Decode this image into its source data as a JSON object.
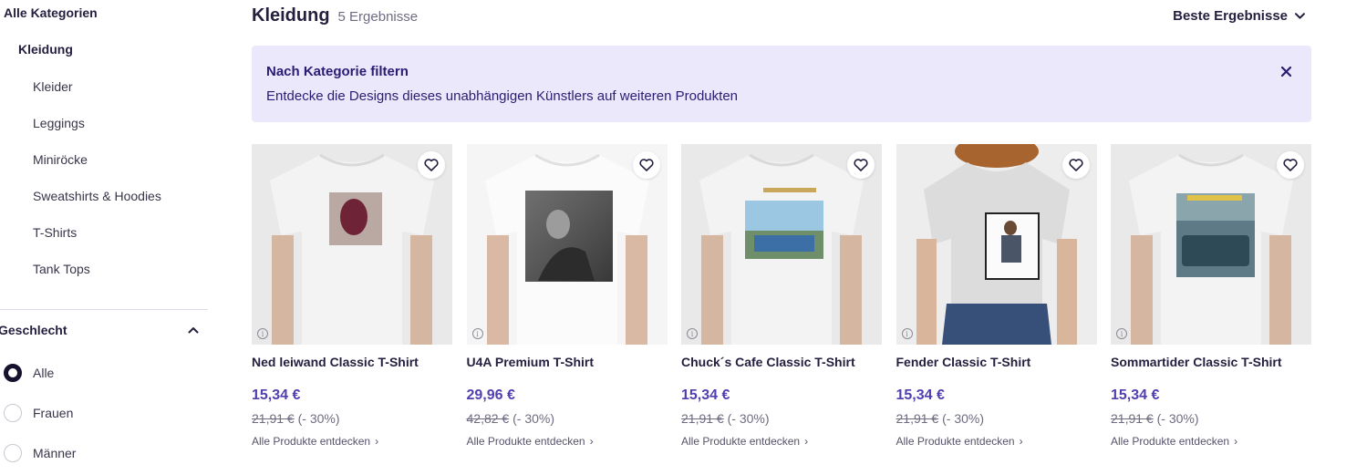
{
  "sidebar": {
    "all_categories": "Alle Kategorien",
    "category": "Kleidung",
    "subcategories": [
      {
        "label": "Kleider"
      },
      {
        "label": "Leggings"
      },
      {
        "label": "Miniröcke"
      },
      {
        "label": "Sweatshirts & Hoodies"
      },
      {
        "label": "T-Shirts"
      },
      {
        "label": "Tank Tops"
      }
    ],
    "gender_title": "Geschlecht",
    "gender_options": [
      {
        "label": "Alle",
        "selected": true
      },
      {
        "label": "Frauen",
        "selected": false
      },
      {
        "label": "Männer",
        "selected": false
      }
    ]
  },
  "header": {
    "title": "Kleidung",
    "count": "5 Ergebnisse",
    "sort_label": "Beste Ergebnisse"
  },
  "banner": {
    "title": "Nach Kategorie filtern",
    "text": "Entdecke die Designs dieses unabhängigen Künstlers auf weiteren Produkten"
  },
  "products": [
    {
      "name": "Ned leiwand Classic T-Shirt",
      "price": "15,34 €",
      "old_price": "21,91 €",
      "discount": "(- 30%)",
      "explore": "Alle Produkte entdecken"
    },
    {
      "name": "U4A Premium T-Shirt",
      "price": "29,96 €",
      "old_price": "42,82 €",
      "discount": "(- 30%)",
      "explore": "Alle Produkte entdecken"
    },
    {
      "name": "Chuck´s Cafe Classic T-Shirt",
      "price": "15,34 €",
      "old_price": "21,91 €",
      "discount": "(- 30%)",
      "explore": "Alle Produkte entdecken"
    },
    {
      "name": "Fender Classic T-Shirt",
      "price": "15,34 €",
      "old_price": "21,91 €",
      "discount": "(- 30%)",
      "explore": "Alle Produkte entdecken"
    },
    {
      "name": "Sommartider Classic T-Shirt",
      "price": "15,34 €",
      "old_price": "21,91 €",
      "discount": "(- 30%)",
      "explore": "Alle Produkte entdecken"
    }
  ],
  "colors": {
    "accent_price": "#4f3fb0",
    "banner_bg": "#ebe8fc",
    "banner_text": "#2b1c73",
    "heading": "#241f3f"
  },
  "icons": {
    "favorite": "heart-icon",
    "info": "info-icon",
    "sort": "chevron-down-icon",
    "collapse": "chevron-up-icon",
    "close": "close-icon",
    "explore": "chevron-right-icon"
  }
}
